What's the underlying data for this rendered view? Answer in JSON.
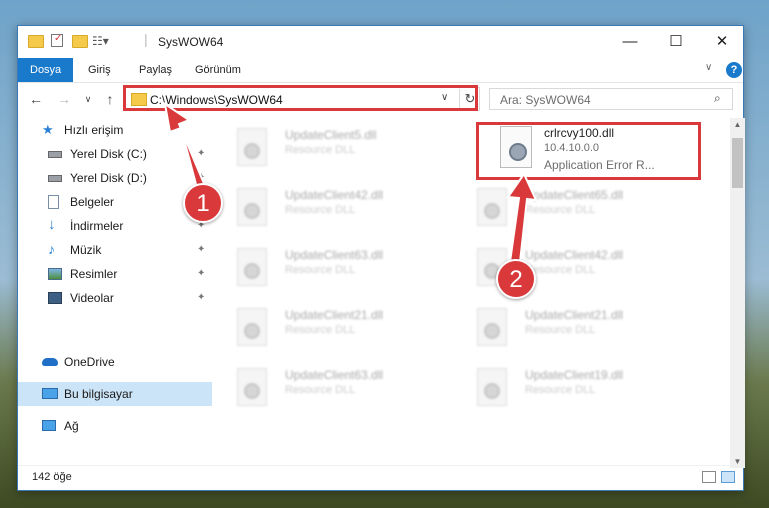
{
  "window": {
    "title": "SysWOW64",
    "controls": {
      "minimize": "—",
      "maximize": "☐",
      "close": "✕"
    }
  },
  "ribbon": {
    "tabs": [
      "Dosya",
      "Giriş",
      "Paylaş",
      "Görünüm"
    ],
    "help": "?"
  },
  "navigation": {
    "address": "C:\\Windows\\SysWOW64",
    "search_placeholder": "Ara: SysWOW64"
  },
  "sidebar": {
    "items": [
      {
        "label": "Hızlı erişim",
        "icon": "star-icon"
      },
      {
        "label": "Yerel Disk (C:)",
        "icon": "drive-icon",
        "pinned": true
      },
      {
        "label": "Yerel Disk (D:)",
        "icon": "drive-icon",
        "pinned": true
      },
      {
        "label": "Belgeler",
        "icon": "document-icon",
        "pinned": true
      },
      {
        "label": "İndirmeler",
        "icon": "download-icon",
        "pinned": true
      },
      {
        "label": "Müzik",
        "icon": "music-icon",
        "pinned": true
      },
      {
        "label": "Resimler",
        "icon": "picture-icon",
        "pinned": true
      },
      {
        "label": "Videolar",
        "icon": "video-icon",
        "pinned": true
      },
      {
        "label": "OneDrive",
        "icon": "cloud-icon"
      },
      {
        "label": "Bu bilgisayar",
        "icon": "computer-icon",
        "selected": true
      },
      {
        "label": "Ağ",
        "icon": "network-icon"
      }
    ]
  },
  "files": {
    "left_column": [
      {
        "name": "UpdateClient5.dll",
        "type": "Resource DLL"
      },
      {
        "name": "UpdateClient42.dll",
        "type": "Resource DLL"
      },
      {
        "name": "UpdateClient63.dll",
        "type": "Resource DLL"
      },
      {
        "name": "UpdateClient21.dll",
        "type": "Resource DLL"
      },
      {
        "name": "UpdateClient63.dll",
        "type": "Resource DLL"
      }
    ],
    "right_column": [
      {
        "name": "crlrcvy100.dll",
        "version": "10.4.10.0.0",
        "description": "Application Error R...",
        "highlighted": true
      },
      {
        "name": "UpdateClient65.dll",
        "type": "Resource DLL"
      },
      {
        "name": "UpdateClient42.dll",
        "type": "Resource DLL"
      },
      {
        "name": "UpdateClient21.dll",
        "type": "Resource DLL"
      },
      {
        "name": "UpdateClient19.dll",
        "type": "Resource DLL"
      }
    ]
  },
  "status": {
    "count": "142 öğe"
  },
  "annotations": {
    "badge1": "1",
    "badge2": "2",
    "color": "#d9393b"
  }
}
